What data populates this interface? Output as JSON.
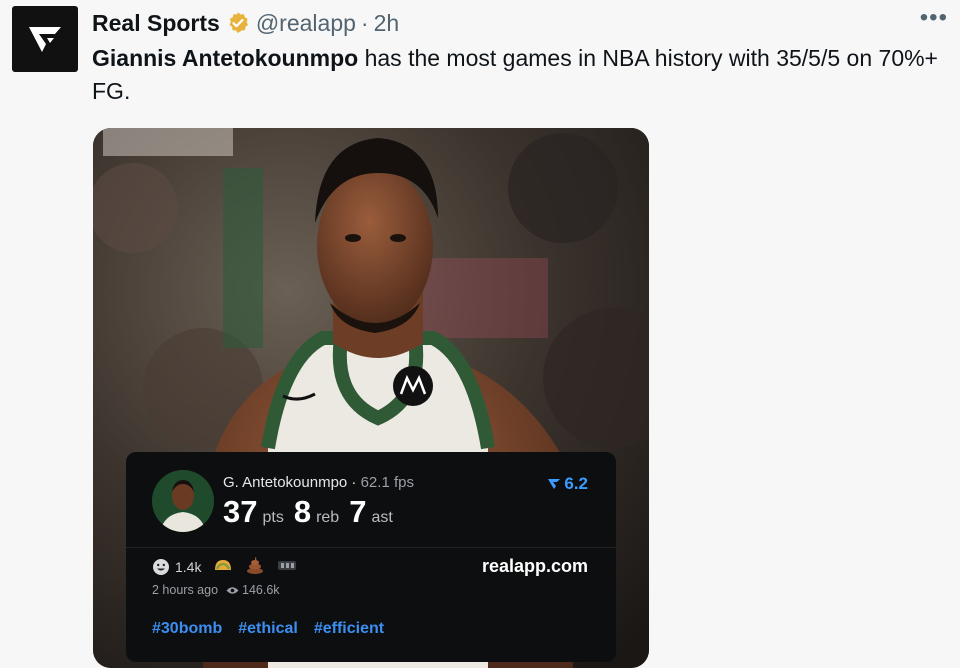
{
  "tweet": {
    "display_name": "Real Sports",
    "handle": "@realapp",
    "separator": "·",
    "time": "2h",
    "more_label": "•••",
    "text_bold": "Giannis Antetokounmpo",
    "text_rest": " has the most games in NBA history with 35/5/5 on 70%+ FG."
  },
  "card": {
    "player_name": "G. Antetokounmpo",
    "separator": "·",
    "fps": "62.1 fps",
    "rank_value": "6.2",
    "stats": [
      {
        "value": "37",
        "label": "pts"
      },
      {
        "value": "8",
        "label": "reb"
      },
      {
        "value": "7",
        "label": "ast"
      }
    ],
    "reaction_count": "1.4k",
    "site": "realapp.com",
    "posted": "2 hours ago",
    "views": "146.6k",
    "hashtags": [
      "#30bomb",
      "#ethical",
      "#efficient"
    ]
  },
  "colors": {
    "link_blue": "#3b8ff0",
    "verified_gold": "#e8b33a",
    "card_bg": "#0d0e10",
    "jersey_green": "#2f5a35"
  },
  "icons": [
    "logo-icon",
    "verified-badge-icon",
    "more-options-icon",
    "rank-arrow-icon",
    "smiley-reaction-icon",
    "taco-reaction-icon",
    "poop-reaction-icon",
    "box-reaction-icon",
    "eye-icon"
  ]
}
